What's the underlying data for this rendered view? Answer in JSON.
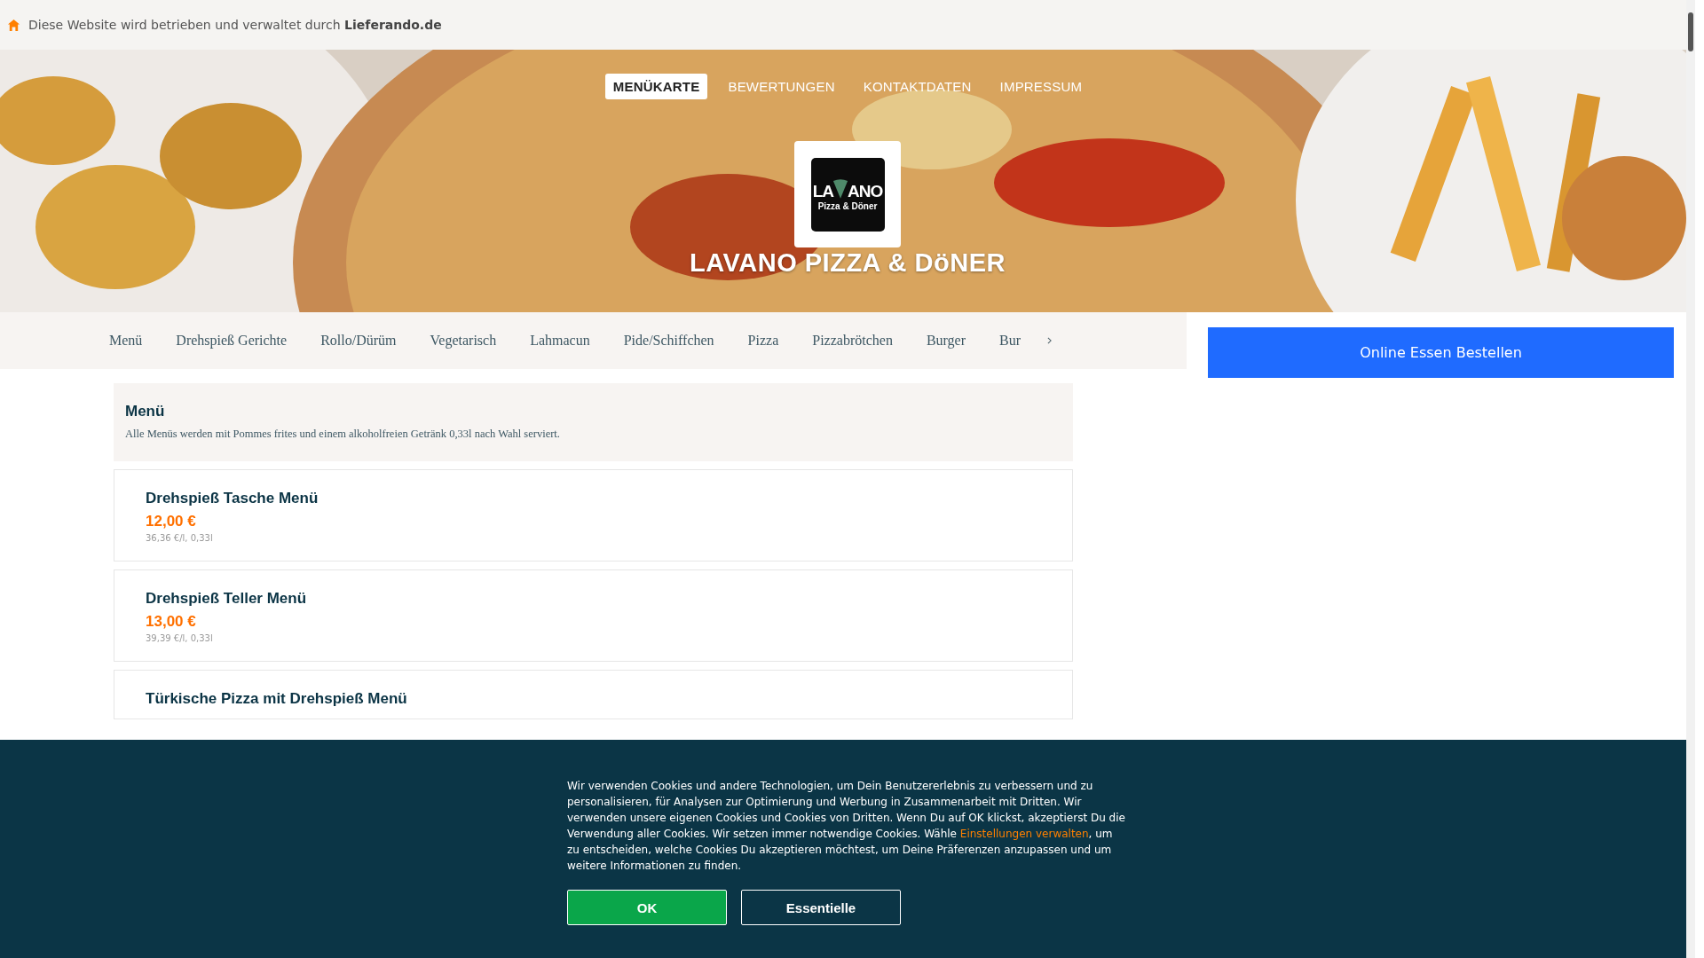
{
  "notice": {
    "text": "Diese Website wird betrieben und verwaltet durch **Lieferando.de**"
  },
  "nav_tabs": [
    {
      "label": "MENÜKARTE",
      "selected": true
    },
    {
      "label": "BEWERTUNGEN",
      "selected": false
    },
    {
      "label": "KONTAKTDATEN",
      "selected": false
    },
    {
      "label": "IMPRESSUM",
      "selected": false
    }
  ],
  "logo": {
    "text_left": "LA",
    "text_right": "ANO",
    "subtitle": "Pizza & Döner"
  },
  "restaurant_name": "LAVANO PIZZA & DöNER",
  "categories": [
    {
      "label": "Menü"
    },
    {
      "label": "Drehspieß Gerichte"
    },
    {
      "label": "Rollo/Dürüm"
    },
    {
      "label": "Vegetarisch"
    },
    {
      "label": "Lahmacun"
    },
    {
      "label": "Pide/Schiffchen"
    },
    {
      "label": "Pizza"
    },
    {
      "label": "Pizzabrötchen"
    },
    {
      "label": "Burger"
    },
    {
      "label": "Bur"
    }
  ],
  "order_button": "Online Essen Bestellen",
  "section": {
    "title": "Menü",
    "description": "Alle Menüs werden mit Pommes frites und einem alkoholfreien Getränk 0,33l nach Wahl serviert."
  },
  "items": [
    {
      "name": "Drehspieß Tasche Menü",
      "price": "12,00 €",
      "unit_price": "36,36 €/l, 0,33l"
    },
    {
      "name": "Drehspieß Teller Menü",
      "price": "13,00 €",
      "unit_price": "39,39 €/l, 0,33l"
    },
    {
      "name": "Türkische Pizza mit Drehspieß Menü"
    }
  ],
  "cookie_banner": {
    "text_before": "Wir verwenden Cookies und andere Technologien, um Dein Benutzererlebnis zu verbessern und zu personalisieren, für Analysen zur Optimierung und Werbung in Zusammenarbeit mit Dritten. Wir verwenden unsere eigenen Cookies und Cookies von Dritten. Wenn Du auf OK klickst, akzeptierst Du die Verwendung aller Cookies. Wir setzen immer notwendige Cookies. Wähle",
    "link": "Einstellungen verwalten",
    "text_after": ", um zu entscheiden, welche Cookies Du akzeptieren möchtest, um Deine Präferenzen anzupassen und um weitere Informationen zu finden.",
    "buttons": [
      {
        "label": "OK",
        "kind": "primary"
      },
      {
        "label": "Essentielle",
        "kind": "secondary"
      }
    ]
  }
}
